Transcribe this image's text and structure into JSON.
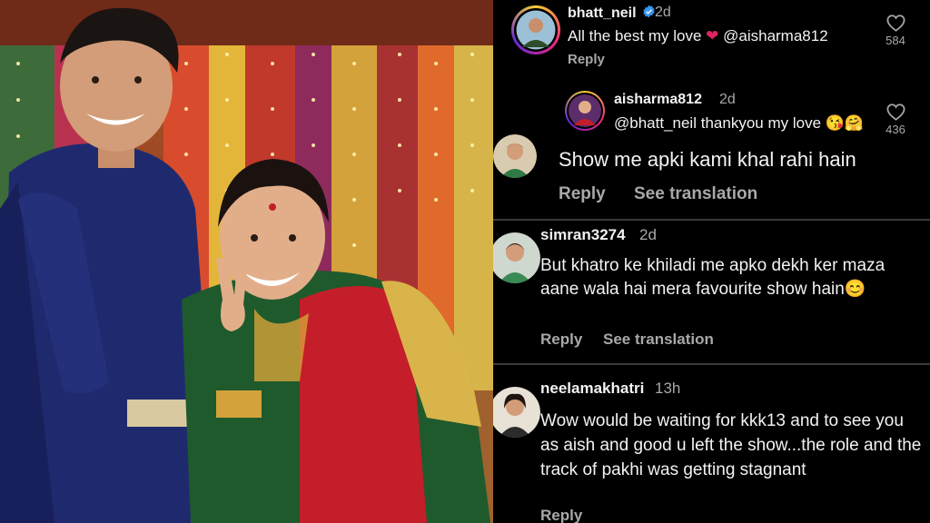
{
  "comments": [
    {
      "username": "bhatt_neil",
      "verified": true,
      "time": "2d",
      "text": "All the best my love",
      "emoji": "❤️",
      "mention": "@aisharma812",
      "reply_label": "Reply",
      "likes": "584"
    },
    {
      "username": "aisharma812",
      "verified": false,
      "time": "2d",
      "mention": "@bhatt_neil",
      "text": "thankyou my love",
      "emoji": "😘🤗",
      "likes": "436"
    },
    {
      "text": "Show me apki kami khal rahi hain",
      "reply_label": "Reply",
      "translation_label": "See translation"
    },
    {
      "username": "simran3274",
      "time": "2d",
      "text": "But khatro ke khiladi me apko dekh ker maza aane wala hai mera favourite show hain",
      "emoji": "😊",
      "reply_label": "Reply",
      "translation_label": "See translation"
    },
    {
      "username": "neelamakhatri",
      "time": "13h",
      "text": "Wow would be waiting for kkk13 and to see you as aish and good u left the show...the role and the track of pakhi was getting stagnant",
      "reply_label": "Reply"
    }
  ],
  "colors": {
    "panel_bg": "#000000",
    "text": "#f2f2f2",
    "muted": "#a8a8a8",
    "verified": "#3897f0",
    "heart_emoji": "#e0245e",
    "story_ring": "#c13584"
  },
  "icons": [
    "heart-outline-icon",
    "verified-badge-icon"
  ]
}
